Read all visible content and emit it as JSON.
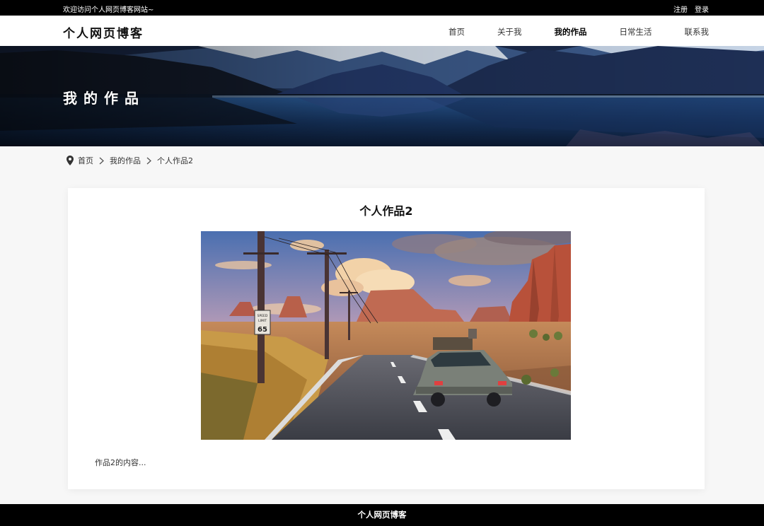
{
  "topbar": {
    "welcome": "欢迎访问个人网页博客网站~",
    "register": "注册",
    "login": "登录"
  },
  "header": {
    "logo": "个人网页博客",
    "nav": [
      {
        "label": "首页",
        "active": false
      },
      {
        "label": "关于我",
        "active": false
      },
      {
        "label": "我的作品",
        "active": true
      },
      {
        "label": "日常生活",
        "active": false
      },
      {
        "label": "联系我",
        "active": false
      }
    ]
  },
  "banner": {
    "title": "我的作品"
  },
  "breadcrumb": {
    "home": "首页",
    "section": "我的作品",
    "current": "个人作品2"
  },
  "article": {
    "title": "个人作品2",
    "sign_text": [
      "SPEED",
      "LIMIT",
      "65"
    ],
    "body": "作品2的内容..."
  },
  "footer": {
    "text": "个人网页博客"
  },
  "colors": {
    "bar_bg": "#000000",
    "page_bg": "#f7f7f7",
    "card_bg": "#ffffff"
  }
}
